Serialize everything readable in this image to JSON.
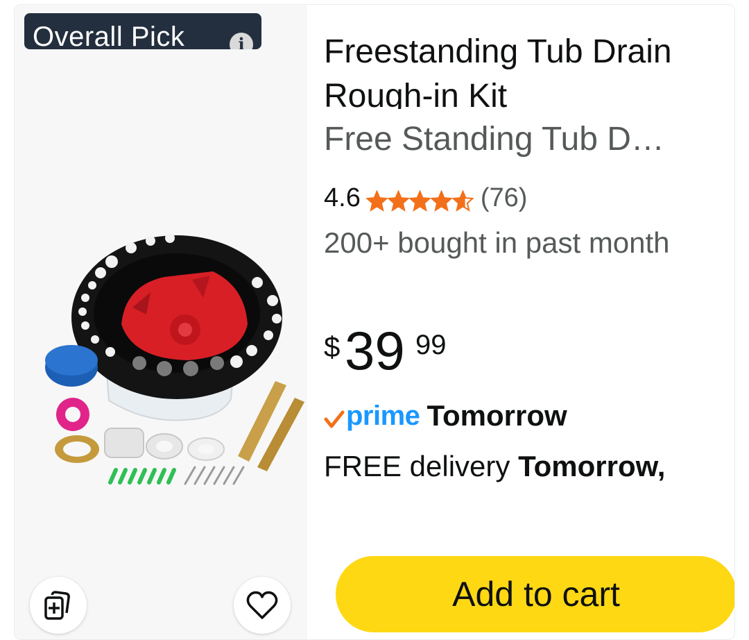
{
  "product": {
    "badge": "Overall Pick",
    "title": "Freestanding Tub Drain Rough-in Kit",
    "subtitle": "Free Standing Tub D…",
    "rating": "4.6",
    "rating_stars": 4.6,
    "review_count": "(76)",
    "bought_text": "200+ bought in past month",
    "price": {
      "symbol": "$",
      "whole": "39",
      "fraction": "99"
    },
    "prime": {
      "label": "prime",
      "delivery_when": "Tomorrow"
    },
    "delivery": {
      "prefix": "FREE delivery ",
      "date": "Tomorrow,"
    },
    "add_to_cart_label": "Add to cart"
  },
  "icons": {
    "info": "info-icon",
    "compare": "compare-icon",
    "wishlist": "heart-icon",
    "star": "star-icon",
    "prime_check": "prime-check-icon"
  },
  "colors": {
    "badge_bg": "#232f3e",
    "star": "#f3701a",
    "prime": "#1a98ff",
    "prime_check": "#f3701a",
    "cart_button": "#ffd814",
    "secondary_text": "#565959"
  }
}
